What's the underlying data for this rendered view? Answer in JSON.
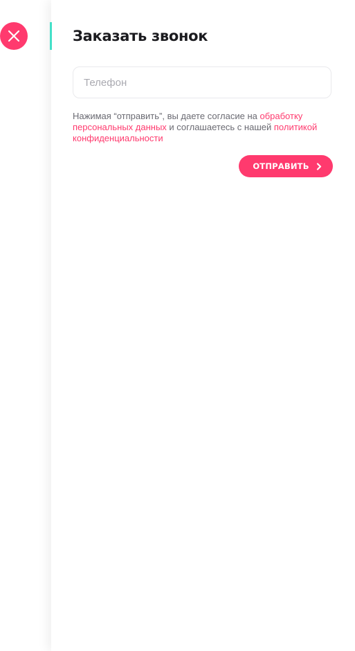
{
  "modal": {
    "title": "Заказать звонок",
    "phone_placeholder": "Телефон",
    "phone_value": "",
    "consent": {
      "prefix": "Нажимая “отправить”, вы даете согласие на ",
      "link1": "обработку персональных данных",
      "middle": " и соглашаетесь с нашей ",
      "link2": "политикой конфиденциальности"
    },
    "submit_label": "ОТПРАВИТЬ"
  },
  "icons": {
    "close": "close-icon",
    "submit_arrow": "chevron-right-icon"
  },
  "colors": {
    "accent": "#ff3a6e",
    "accent_bar": "#43e0c8",
    "title": "#1b1b1f",
    "body_text": "#6a6a72",
    "placeholder": "#a9a9b0"
  }
}
